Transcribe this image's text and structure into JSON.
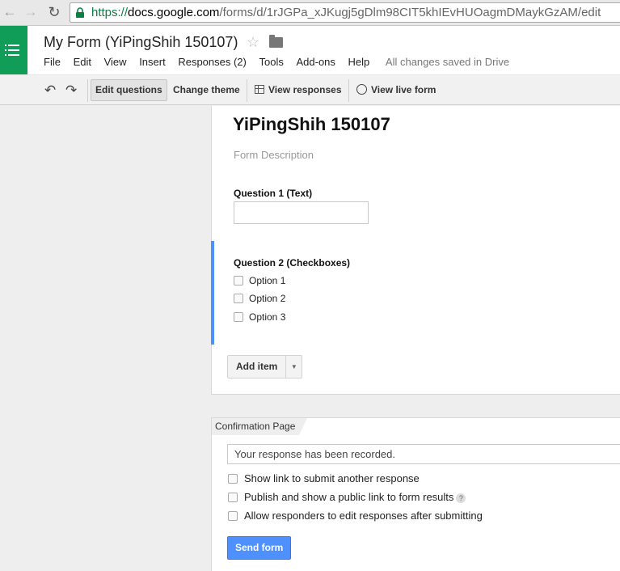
{
  "browser": {
    "url_https": "https://",
    "url_host": "docs.google.com",
    "url_path": "/forms/d/1rJGPa_xJKugj5gDlm98CIT5khIEvHUOagmDMaykGzAM/edit",
    "icons": [
      "back-arrow-icon",
      "forward-arrow-icon",
      "reload-icon",
      "lock-icon"
    ]
  },
  "header": {
    "doc_title": "My Form (YiPingShih 150107)",
    "menu": [
      "File",
      "Edit",
      "View",
      "Insert",
      "Responses (2)",
      "Tools",
      "Add-ons",
      "Help"
    ],
    "saved_status": "All changes saved in Drive",
    "brand_color": "#0f9d58"
  },
  "toolbar": {
    "edit_questions": "Edit questions",
    "change_theme": "Change theme",
    "view_responses": "View responses",
    "view_live_form": "View live form"
  },
  "form": {
    "title": "YiPingShih 150107",
    "description_placeholder": "Form Description",
    "q1_label": "Question 1 (Text)",
    "q1_value": "",
    "q2_label": "Question 2 (Checkboxes)",
    "q2_options": [
      "Option 1",
      "Option 2",
      "Option 3"
    ],
    "add_item": "Add item"
  },
  "confirmation": {
    "tab_label": "Confirmation Page",
    "message": "Your response has been recorded.",
    "options": [
      "Show link to submit another response",
      "Publish and show a public link to form results",
      "Allow responders to edit responses after submitting"
    ],
    "send_button": "Send form",
    "accent_color": "#4d90fe"
  }
}
